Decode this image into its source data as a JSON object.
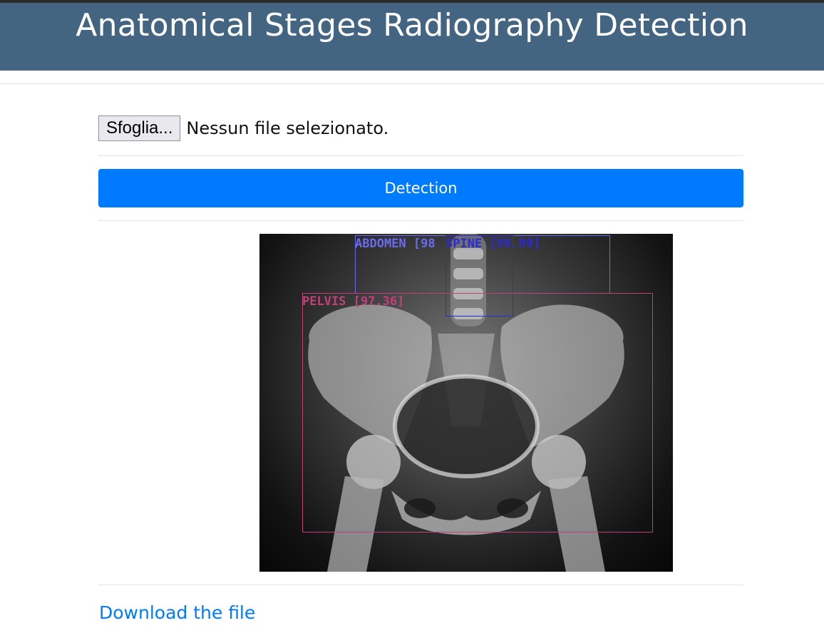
{
  "header": {
    "title": "Anatomical Stages Radiography Detection",
    "color": "#446582"
  },
  "upload": {
    "browse_label": "Sfoglia...",
    "status": "Nessun file selezionato."
  },
  "detect_button": {
    "label": "Detection",
    "color": "#007bff"
  },
  "result_image": {
    "detections": [
      {
        "label": "ABDOMEN [98",
        "color": "#6b6bf0"
      },
      {
        "label": "SPINE [99.99]",
        "color": "#2a2ad8"
      },
      {
        "label": "PELVIS [97.36]",
        "color": "#c0407a"
      }
    ]
  },
  "download_link": {
    "label": "Download the file"
  }
}
